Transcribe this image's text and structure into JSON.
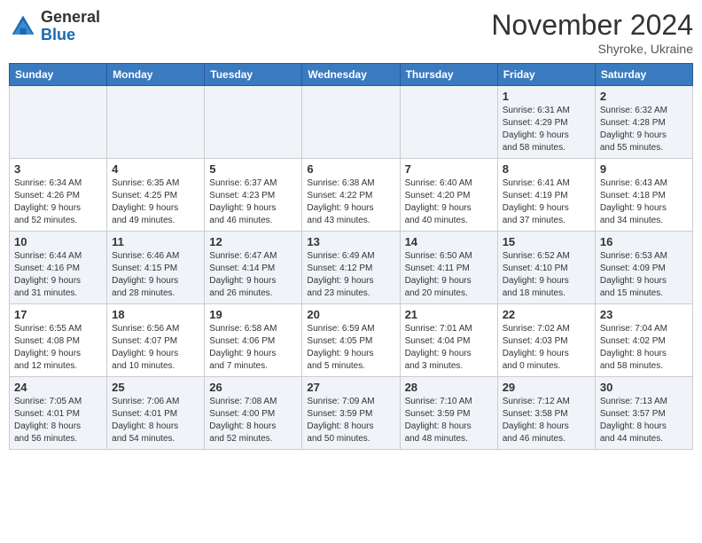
{
  "header": {
    "logo_general": "General",
    "logo_blue": "Blue",
    "month_title": "November 2024",
    "location": "Shyroke, Ukraine"
  },
  "days_of_week": [
    "Sunday",
    "Monday",
    "Tuesday",
    "Wednesday",
    "Thursday",
    "Friday",
    "Saturday"
  ],
  "weeks": [
    [
      {
        "day": "",
        "info": ""
      },
      {
        "day": "",
        "info": ""
      },
      {
        "day": "",
        "info": ""
      },
      {
        "day": "",
        "info": ""
      },
      {
        "day": "",
        "info": ""
      },
      {
        "day": "1",
        "info": "Sunrise: 6:31 AM\nSunset: 4:29 PM\nDaylight: 9 hours\nand 58 minutes."
      },
      {
        "day": "2",
        "info": "Sunrise: 6:32 AM\nSunset: 4:28 PM\nDaylight: 9 hours\nand 55 minutes."
      }
    ],
    [
      {
        "day": "3",
        "info": "Sunrise: 6:34 AM\nSunset: 4:26 PM\nDaylight: 9 hours\nand 52 minutes."
      },
      {
        "day": "4",
        "info": "Sunrise: 6:35 AM\nSunset: 4:25 PM\nDaylight: 9 hours\nand 49 minutes."
      },
      {
        "day": "5",
        "info": "Sunrise: 6:37 AM\nSunset: 4:23 PM\nDaylight: 9 hours\nand 46 minutes."
      },
      {
        "day": "6",
        "info": "Sunrise: 6:38 AM\nSunset: 4:22 PM\nDaylight: 9 hours\nand 43 minutes."
      },
      {
        "day": "7",
        "info": "Sunrise: 6:40 AM\nSunset: 4:20 PM\nDaylight: 9 hours\nand 40 minutes."
      },
      {
        "day": "8",
        "info": "Sunrise: 6:41 AM\nSunset: 4:19 PM\nDaylight: 9 hours\nand 37 minutes."
      },
      {
        "day": "9",
        "info": "Sunrise: 6:43 AM\nSunset: 4:18 PM\nDaylight: 9 hours\nand 34 minutes."
      }
    ],
    [
      {
        "day": "10",
        "info": "Sunrise: 6:44 AM\nSunset: 4:16 PM\nDaylight: 9 hours\nand 31 minutes."
      },
      {
        "day": "11",
        "info": "Sunrise: 6:46 AM\nSunset: 4:15 PM\nDaylight: 9 hours\nand 28 minutes."
      },
      {
        "day": "12",
        "info": "Sunrise: 6:47 AM\nSunset: 4:14 PM\nDaylight: 9 hours\nand 26 minutes."
      },
      {
        "day": "13",
        "info": "Sunrise: 6:49 AM\nSunset: 4:12 PM\nDaylight: 9 hours\nand 23 minutes."
      },
      {
        "day": "14",
        "info": "Sunrise: 6:50 AM\nSunset: 4:11 PM\nDaylight: 9 hours\nand 20 minutes."
      },
      {
        "day": "15",
        "info": "Sunrise: 6:52 AM\nSunset: 4:10 PM\nDaylight: 9 hours\nand 18 minutes."
      },
      {
        "day": "16",
        "info": "Sunrise: 6:53 AM\nSunset: 4:09 PM\nDaylight: 9 hours\nand 15 minutes."
      }
    ],
    [
      {
        "day": "17",
        "info": "Sunrise: 6:55 AM\nSunset: 4:08 PM\nDaylight: 9 hours\nand 12 minutes."
      },
      {
        "day": "18",
        "info": "Sunrise: 6:56 AM\nSunset: 4:07 PM\nDaylight: 9 hours\nand 10 minutes."
      },
      {
        "day": "19",
        "info": "Sunrise: 6:58 AM\nSunset: 4:06 PM\nDaylight: 9 hours\nand 7 minutes."
      },
      {
        "day": "20",
        "info": "Sunrise: 6:59 AM\nSunset: 4:05 PM\nDaylight: 9 hours\nand 5 minutes."
      },
      {
        "day": "21",
        "info": "Sunrise: 7:01 AM\nSunset: 4:04 PM\nDaylight: 9 hours\nand 3 minutes."
      },
      {
        "day": "22",
        "info": "Sunrise: 7:02 AM\nSunset: 4:03 PM\nDaylight: 9 hours\nand 0 minutes."
      },
      {
        "day": "23",
        "info": "Sunrise: 7:04 AM\nSunset: 4:02 PM\nDaylight: 8 hours\nand 58 minutes."
      }
    ],
    [
      {
        "day": "24",
        "info": "Sunrise: 7:05 AM\nSunset: 4:01 PM\nDaylight: 8 hours\nand 56 minutes."
      },
      {
        "day": "25",
        "info": "Sunrise: 7:06 AM\nSunset: 4:01 PM\nDaylight: 8 hours\nand 54 minutes."
      },
      {
        "day": "26",
        "info": "Sunrise: 7:08 AM\nSunset: 4:00 PM\nDaylight: 8 hours\nand 52 minutes."
      },
      {
        "day": "27",
        "info": "Sunrise: 7:09 AM\nSunset: 3:59 PM\nDaylight: 8 hours\nand 50 minutes."
      },
      {
        "day": "28",
        "info": "Sunrise: 7:10 AM\nSunset: 3:59 PM\nDaylight: 8 hours\nand 48 minutes."
      },
      {
        "day": "29",
        "info": "Sunrise: 7:12 AM\nSunset: 3:58 PM\nDaylight: 8 hours\nand 46 minutes."
      },
      {
        "day": "30",
        "info": "Sunrise: 7:13 AM\nSunset: 3:57 PM\nDaylight: 8 hours\nand 44 minutes."
      }
    ]
  ]
}
